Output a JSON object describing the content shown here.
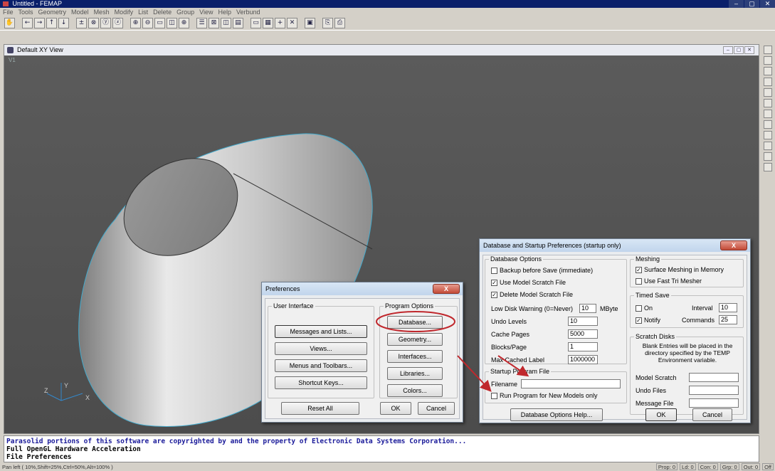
{
  "window": {
    "title": "Untitled - FEMAP",
    "controls": [
      "–",
      "▢",
      "✕"
    ]
  },
  "menubar": [
    "File",
    "Tools",
    "Geometry",
    "Model",
    "Mesh",
    "Modify",
    "List",
    "Delete",
    "Group",
    "View",
    "Help",
    "Verbund"
  ],
  "toolbar_icons": [
    "pan-icon",
    "left-arrow-icon",
    "right-arrow-icon",
    "up-arrow-icon",
    "down-arrow-icon",
    "rotate-plus-icon",
    "rotate-x-icon",
    "rotate-y-icon",
    "rotate-z-icon",
    "zoom-in-icon",
    "zoom-out-icon",
    "window-zoom-icon",
    "autoscale-icon",
    "center-icon",
    "list-icon",
    "box-icon",
    "cube-icon",
    "render-icon",
    "screen-icon",
    "grid-icon",
    "plus-icon",
    "close-x-icon",
    "window-icon",
    "copy-icon",
    "print-icon"
  ],
  "view": {
    "title": "Default XY View",
    "label": "V1",
    "axes": {
      "z": "Z",
      "y": "Y",
      "x": "X"
    }
  },
  "messages": [
    "Parasolid portions of this software are copyrighted by and the property of Electronic Data Systems Corporation...",
    "Full OpenGL Hardware Acceleration",
    "File Preferences"
  ],
  "statusbar": {
    "text": "Pan left ( 10%,Shift=25%,Ctrl=50%,Alt=100% )",
    "stats": [
      "Prop: 0",
      "Ld: 0",
      "Con: 0",
      "Grp: 0",
      "Out: 0",
      "Off"
    ]
  },
  "preferences": {
    "title": "Preferences",
    "close": "X",
    "user_interface": {
      "label": "User Interface",
      "buttons": [
        "Messages and Lists...",
        "Views...",
        "Menus and Toolbars...",
        "Shortcut Keys..."
      ]
    },
    "program_options": {
      "label": "Program Options",
      "buttons": [
        "Database...",
        "Geometry...",
        "Interfaces...",
        "Libraries...",
        "Colors..."
      ]
    },
    "reset": "Reset All",
    "ok": "OK",
    "cancel": "Cancel"
  },
  "database": {
    "title": "Database and Startup Preferences (startup only)",
    "close": "X",
    "db_options": {
      "label": "Database Options",
      "checks": [
        {
          "label": "Backup before Save (immediate)",
          "checked": false
        },
        {
          "label": "Use Model Scratch File",
          "checked": true
        },
        {
          "label": "Delete Model Scratch File",
          "checked": true
        }
      ],
      "low_disk_label": "Low Disk Warning (0=Never)",
      "low_disk_value": "10",
      "low_disk_unit": "MByte",
      "undo_label": "Undo Levels",
      "undo_value": "10",
      "cache_label": "Cache Pages",
      "cache_value": "5000",
      "blocks_label": "Blocks/Page",
      "blocks_value": "1",
      "max_label": "Max Cached Label",
      "max_value": "1000000"
    },
    "meshing": {
      "label": "Meshing",
      "checks": [
        {
          "label": "Surface Meshing in Memory",
          "checked": true
        },
        {
          "label": "Use Fast Tri Mesher",
          "checked": false
        }
      ]
    },
    "timed_save": {
      "label": "Timed Save",
      "on_label": "On",
      "on_checked": false,
      "interval_label": "Interval",
      "interval_value": "10",
      "notify_label": "Notify",
      "notify_checked": true,
      "commands_label": "Commands",
      "commands_value": "25"
    },
    "scratch": {
      "label": "Scratch Disks",
      "note": "Blank Entries will be placed in the directory specified by the TEMP Environment variable.",
      "model_label": "Model Scratch",
      "undo_label": "Undo Files",
      "message_label": "Message File"
    },
    "startup": {
      "label": "Startup Program File",
      "filename_label": "Filename",
      "run_label": "Run Program for New Models only",
      "run_checked": false
    },
    "help": "Database Options Help...",
    "ok": "OK",
    "cancel": "Cancel"
  },
  "colors": {
    "annotation": "#c0282d",
    "model_light": "#e6e6e6",
    "model_dark": "#8a8a8a"
  }
}
